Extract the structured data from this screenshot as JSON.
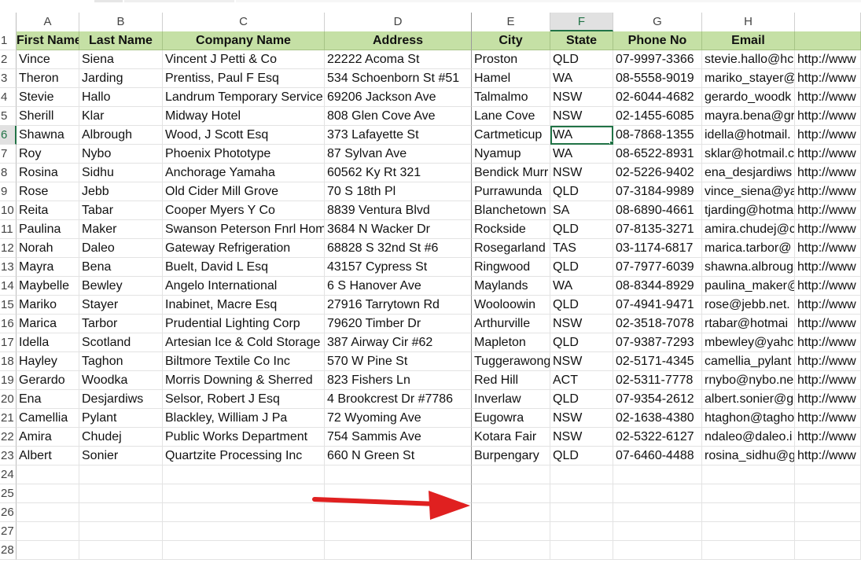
{
  "columns": [
    "A",
    "B",
    "C",
    "D",
    "E",
    "F",
    "G",
    "H",
    ""
  ],
  "selected_column": "F",
  "header_row": {
    "row_num": "1",
    "cells": [
      "First Name",
      "Last Name",
      "Company Name",
      "Address",
      "City",
      "State",
      "Phone No",
      "Email",
      ""
    ]
  },
  "rows": [
    {
      "n": "2",
      "c": [
        "Vince",
        "Siena",
        "Vincent J Petti & Co",
        "22222 Acoma St",
        "Proston",
        "QLD",
        "07-9997-3366",
        "stevie.hallo@hc",
        "http://www"
      ]
    },
    {
      "n": "3",
      "c": [
        "Theron",
        "Jarding",
        "Prentiss, Paul F Esq",
        "534 Schoenborn St #51",
        "Hamel",
        "WA",
        "08-5558-9019",
        "mariko_stayer@",
        "http://www"
      ]
    },
    {
      "n": "4",
      "c": [
        "Stevie",
        "Hallo",
        "Landrum Temporary Service",
        "69206 Jackson Ave",
        "Talmalmo",
        "NSW",
        "02-6044-4682",
        "gerardo_woodk",
        "http://www"
      ]
    },
    {
      "n": "5",
      "c": [
        "Sherill",
        "Klar",
        "Midway Hotel",
        "808 Glen Cove Ave",
        "Lane Cove",
        "NSW",
        "02-1455-6085",
        "mayra.bena@gr",
        "http://www"
      ]
    },
    {
      "n": "6",
      "c": [
        "Shawna",
        "Albrough",
        "Wood, J Scott Esq",
        "373 Lafayette St",
        "Cartmeticup",
        "WA",
        "08-7868-1355",
        "idella@hotmail.",
        "http://www"
      ]
    },
    {
      "n": "7",
      "c": [
        "Roy",
        "Nybo",
        "Phoenix Phototype",
        "87 Sylvan Ave",
        "Nyamup",
        "WA",
        "08-6522-8931",
        "sklar@hotmail.c",
        "http://www"
      ]
    },
    {
      "n": "8",
      "c": [
        "Rosina",
        "Sidhu",
        "Anchorage Yamaha",
        "60562 Ky Rt 321",
        "Bendick Murr",
        "NSW",
        "02-5226-9402",
        "ena_desjardiws",
        "http://www"
      ]
    },
    {
      "n": "9",
      "c": [
        "Rose",
        "Jebb",
        "Old Cider Mill Grove",
        "70 S 18th Pl",
        "Purrawunda",
        "QLD",
        "07-3184-9989",
        "vince_siena@ya",
        "http://www"
      ]
    },
    {
      "n": "10",
      "c": [
        "Reita",
        "Tabar",
        "Cooper Myers Y Co",
        "8839 Ventura Blvd",
        "Blanchetown",
        "SA",
        "08-6890-4661",
        "tjarding@hotma",
        "http://www"
      ]
    },
    {
      "n": "11",
      "c": [
        "Paulina",
        "Maker",
        "Swanson Peterson Fnrl Hom",
        "3684 N Wacker Dr",
        "Rockside",
        "QLD",
        "07-8135-3271",
        "amira.chudej@c",
        "http://www"
      ]
    },
    {
      "n": "12",
      "c": [
        "Norah",
        "Daleo",
        "Gateway Refrigeration",
        "68828 S 32nd St #6",
        "Rosegarland",
        "TAS",
        "03-1174-6817",
        "marica.tarbor@",
        "http://www"
      ]
    },
    {
      "n": "13",
      "c": [
        "Mayra",
        "Bena",
        "Buelt, David L Esq",
        "43157 Cypress St",
        "Ringwood",
        "QLD",
        "07-7977-6039",
        "shawna.albroug",
        "http://www"
      ]
    },
    {
      "n": "14",
      "c": [
        "Maybelle",
        "Bewley",
        "Angelo International",
        "6 S Hanover Ave",
        "Maylands",
        "WA",
        "08-8344-8929",
        "paulina_maker@",
        "http://www"
      ]
    },
    {
      "n": "15",
      "c": [
        "Mariko",
        "Stayer",
        "Inabinet, Macre Esq",
        "27916 Tarrytown Rd",
        "Wooloowin",
        "QLD",
        "07-4941-9471",
        "rose@jebb.net.",
        "http://www"
      ]
    },
    {
      "n": "16",
      "c": [
        "Marica",
        "Tarbor",
        "Prudential Lighting Corp",
        "79620 Timber Dr",
        "Arthurville",
        "NSW",
        "02-3518-7078",
        "rtabar@hotmai",
        "http://www"
      ]
    },
    {
      "n": "17",
      "c": [
        "Idella",
        "Scotland",
        "Artesian Ice & Cold Storage",
        "387 Airway Cir #62",
        "Mapleton",
        "QLD",
        "07-9387-7293",
        "mbewley@yahc",
        "http://www"
      ]
    },
    {
      "n": "18",
      "c": [
        "Hayley",
        "Taghon",
        "Biltmore Textile Co Inc",
        "570 W Pine St",
        "Tuggerawong",
        "NSW",
        "02-5171-4345",
        "camellia_pylant",
        "http://www"
      ]
    },
    {
      "n": "19",
      "c": [
        "Gerardo",
        "Woodka",
        "Morris Downing & Sherred",
        "823 Fishers Ln",
        "Red Hill",
        "ACT",
        "02-5311-7778",
        "rnybo@nybo.ne",
        "http://www"
      ]
    },
    {
      "n": "20",
      "c": [
        "Ena",
        "Desjardiws",
        "Selsor, Robert J Esq",
        "4 Brookcrest Dr #7786",
        "Inverlaw",
        "QLD",
        "07-9354-2612",
        "albert.sonier@g",
        "http://www"
      ]
    },
    {
      "n": "21",
      "c": [
        "Camellia",
        "Pylant",
        "Blackley, William J Pa",
        "72 Wyoming Ave",
        "Eugowra",
        "NSW",
        "02-1638-4380",
        "htaghon@tagho",
        "http://www"
      ]
    },
    {
      "n": "22",
      "c": [
        "Amira",
        "Chudej",
        "Public Works Department",
        "754 Sammis Ave",
        "Kotara Fair",
        "NSW",
        "02-5322-6127",
        "ndaleo@daleo.i",
        "http://www"
      ]
    },
    {
      "n": "23",
      "c": [
        "Albert",
        "Sonier",
        "Quartzite Processing Inc",
        "660 N Green St",
        "Burpengary",
        "QLD",
        "07-6460-4488",
        "rosina_sidhu@g",
        "http://www"
      ]
    },
    {
      "n": "24",
      "c": [
        "",
        "",
        "",
        "",
        "",
        "",
        "",
        "",
        ""
      ]
    },
    {
      "n": "25",
      "c": [
        "",
        "",
        "",
        "",
        "",
        "",
        "",
        "",
        ""
      ]
    },
    {
      "n": "26",
      "c": [
        "",
        "",
        "",
        "",
        "",
        "",
        "",
        "",
        ""
      ]
    },
    {
      "n": "27",
      "c": [
        "",
        "",
        "",
        "",
        "",
        "",
        "",
        "",
        ""
      ]
    },
    {
      "n": "28",
      "c": [
        "",
        "",
        "",
        "",
        "",
        "",
        "",
        "",
        ""
      ]
    }
  ],
  "active_cell": {
    "row": "6",
    "col": "F"
  },
  "colors": {
    "header_fill": "#c5e0a5",
    "selection": "#217346",
    "arrow": "#e02020"
  },
  "annotation": "red-arrow-icon"
}
